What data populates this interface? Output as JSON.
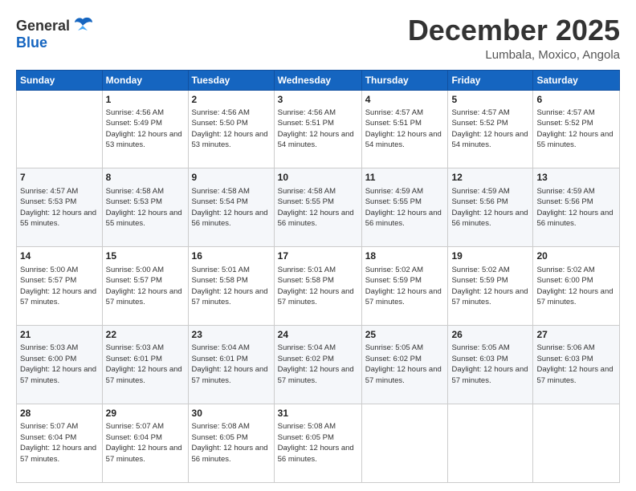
{
  "header": {
    "logo_line1": "General",
    "logo_line2": "Blue",
    "month_title": "December 2025",
    "subtitle": "Lumbala, Moxico, Angola"
  },
  "days_of_week": [
    "Sunday",
    "Monday",
    "Tuesday",
    "Wednesday",
    "Thursday",
    "Friday",
    "Saturday"
  ],
  "weeks": [
    [
      {
        "day": "",
        "sunrise": "",
        "sunset": "",
        "daylight": ""
      },
      {
        "day": "1",
        "sunrise": "4:56 AM",
        "sunset": "5:49 PM",
        "daylight": "12 hours and 53 minutes."
      },
      {
        "day": "2",
        "sunrise": "4:56 AM",
        "sunset": "5:50 PM",
        "daylight": "12 hours and 53 minutes."
      },
      {
        "day": "3",
        "sunrise": "4:56 AM",
        "sunset": "5:51 PM",
        "daylight": "12 hours and 54 minutes."
      },
      {
        "day": "4",
        "sunrise": "4:57 AM",
        "sunset": "5:51 PM",
        "daylight": "12 hours and 54 minutes."
      },
      {
        "day": "5",
        "sunrise": "4:57 AM",
        "sunset": "5:52 PM",
        "daylight": "12 hours and 54 minutes."
      },
      {
        "day": "6",
        "sunrise": "4:57 AM",
        "sunset": "5:52 PM",
        "daylight": "12 hours and 55 minutes."
      }
    ],
    [
      {
        "day": "7",
        "sunrise": "4:57 AM",
        "sunset": "5:53 PM",
        "daylight": "12 hours and 55 minutes."
      },
      {
        "day": "8",
        "sunrise": "4:58 AM",
        "sunset": "5:53 PM",
        "daylight": "12 hours and 55 minutes."
      },
      {
        "day": "9",
        "sunrise": "4:58 AM",
        "sunset": "5:54 PM",
        "daylight": "12 hours and 56 minutes."
      },
      {
        "day": "10",
        "sunrise": "4:58 AM",
        "sunset": "5:55 PM",
        "daylight": "12 hours and 56 minutes."
      },
      {
        "day": "11",
        "sunrise": "4:59 AM",
        "sunset": "5:55 PM",
        "daylight": "12 hours and 56 minutes."
      },
      {
        "day": "12",
        "sunrise": "4:59 AM",
        "sunset": "5:56 PM",
        "daylight": "12 hours and 56 minutes."
      },
      {
        "day": "13",
        "sunrise": "4:59 AM",
        "sunset": "5:56 PM",
        "daylight": "12 hours and 56 minutes."
      }
    ],
    [
      {
        "day": "14",
        "sunrise": "5:00 AM",
        "sunset": "5:57 PM",
        "daylight": "12 hours and 57 minutes."
      },
      {
        "day": "15",
        "sunrise": "5:00 AM",
        "sunset": "5:57 PM",
        "daylight": "12 hours and 57 minutes."
      },
      {
        "day": "16",
        "sunrise": "5:01 AM",
        "sunset": "5:58 PM",
        "daylight": "12 hours and 57 minutes."
      },
      {
        "day": "17",
        "sunrise": "5:01 AM",
        "sunset": "5:58 PM",
        "daylight": "12 hours and 57 minutes."
      },
      {
        "day": "18",
        "sunrise": "5:02 AM",
        "sunset": "5:59 PM",
        "daylight": "12 hours and 57 minutes."
      },
      {
        "day": "19",
        "sunrise": "5:02 AM",
        "sunset": "5:59 PM",
        "daylight": "12 hours and 57 minutes."
      },
      {
        "day": "20",
        "sunrise": "5:02 AM",
        "sunset": "6:00 PM",
        "daylight": "12 hours and 57 minutes."
      }
    ],
    [
      {
        "day": "21",
        "sunrise": "5:03 AM",
        "sunset": "6:00 PM",
        "daylight": "12 hours and 57 minutes."
      },
      {
        "day": "22",
        "sunrise": "5:03 AM",
        "sunset": "6:01 PM",
        "daylight": "12 hours and 57 minutes."
      },
      {
        "day": "23",
        "sunrise": "5:04 AM",
        "sunset": "6:01 PM",
        "daylight": "12 hours and 57 minutes."
      },
      {
        "day": "24",
        "sunrise": "5:04 AM",
        "sunset": "6:02 PM",
        "daylight": "12 hours and 57 minutes."
      },
      {
        "day": "25",
        "sunrise": "5:05 AM",
        "sunset": "6:02 PM",
        "daylight": "12 hours and 57 minutes."
      },
      {
        "day": "26",
        "sunrise": "5:05 AM",
        "sunset": "6:03 PM",
        "daylight": "12 hours and 57 minutes."
      },
      {
        "day": "27",
        "sunrise": "5:06 AM",
        "sunset": "6:03 PM",
        "daylight": "12 hours and 57 minutes."
      }
    ],
    [
      {
        "day": "28",
        "sunrise": "5:07 AM",
        "sunset": "6:04 PM",
        "daylight": "12 hours and 57 minutes."
      },
      {
        "day": "29",
        "sunrise": "5:07 AM",
        "sunset": "6:04 PM",
        "daylight": "12 hours and 57 minutes."
      },
      {
        "day": "30",
        "sunrise": "5:08 AM",
        "sunset": "6:05 PM",
        "daylight": "12 hours and 56 minutes."
      },
      {
        "day": "31",
        "sunrise": "5:08 AM",
        "sunset": "6:05 PM",
        "daylight": "12 hours and 56 minutes."
      },
      {
        "day": "",
        "sunrise": "",
        "sunset": "",
        "daylight": ""
      },
      {
        "day": "",
        "sunrise": "",
        "sunset": "",
        "daylight": ""
      },
      {
        "day": "",
        "sunrise": "",
        "sunset": "",
        "daylight": ""
      }
    ]
  ]
}
